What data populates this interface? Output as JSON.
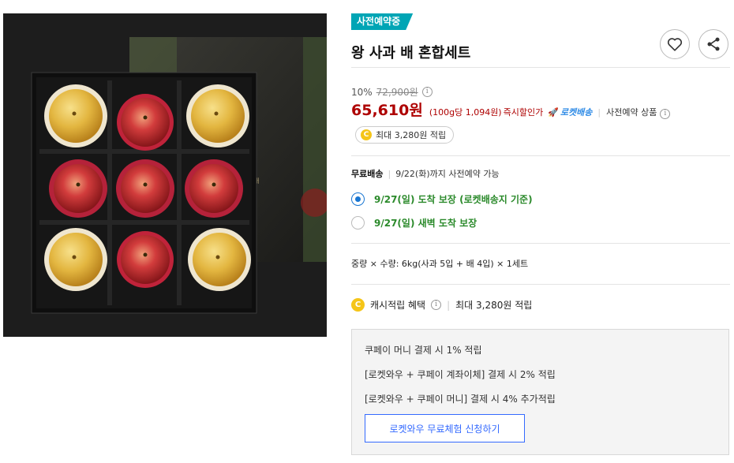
{
  "product": {
    "badge": "사전예약중",
    "title": "왕 사과 배 혼합세트"
  },
  "price": {
    "discount_rate": "10%",
    "original_price": "72,900원",
    "sale_price": "65,610원",
    "unit_price": "(100g당 1,094원)",
    "instant_discount": "즉시할인가",
    "rocket_label": "로켓배송",
    "pre_order_label": "사전예약 상품"
  },
  "cash_pill": {
    "coin": "C",
    "text": "최대 3,280원 적립"
  },
  "delivery": {
    "label": "무료배송",
    "date_info": "9/22(화)까지 사전예약 가능",
    "options": [
      {
        "label": "9/27(일) 도착 보장 (로켓배송지 기준)",
        "selected": true
      },
      {
        "label": "9/27(일) 새벽 도착 보장",
        "selected": false
      }
    ]
  },
  "option_summary": "중량 × 수량: 6kg(사과 5입 + 배 4입) × 1세트",
  "cash_benefit": {
    "coin": "C",
    "label": "캐시적립 혜택",
    "value": "최대 3,280원 적립"
  },
  "benefit_box": {
    "lines": [
      "쿠페이 머니 결제 시 1% 적립",
      "[로켓와우 + 쿠페이 계좌이체] 결제 시 2% 적립",
      "[로켓와우 + 쿠페이 머니] 결제 시 4% 추가적립"
    ],
    "button_label": "로켓와우 무료체험 신청하기"
  },
  "icons": {
    "heart": "heart-icon",
    "share": "share-icon",
    "info": "info-icon",
    "rocket": "rocket-icon"
  },
  "colors": {
    "badge": "#00a5b5",
    "sale_price": "#ae0000",
    "rocket": "#2f8be6",
    "delivery_option": "#2b8a2b",
    "radio_selected": "#1976d2",
    "wow_button": "#346aff",
    "coin": "#f5c518"
  }
}
